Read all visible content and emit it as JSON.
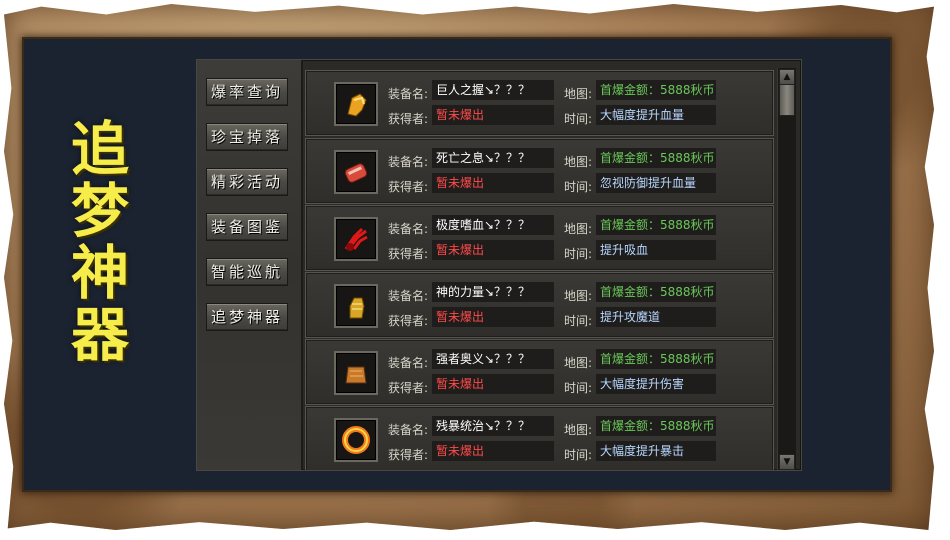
{
  "title": "追梦神器",
  "menu": [
    {
      "label": "爆率查询"
    },
    {
      "label": "珍宝掉落"
    },
    {
      "label": "精彩活动"
    },
    {
      "label": "装备图鉴"
    },
    {
      "label": "智能巡航"
    },
    {
      "label": "追梦神器"
    }
  ],
  "labels": {
    "equip": "装备名:",
    "obtainer": "获得者:",
    "map": "地图:",
    "time": "时间:"
  },
  "items": [
    {
      "icon": "gauntlet-gold-icon",
      "name": "巨人之握↘？？？",
      "obtainer": "暂未爆出",
      "map": "首爆金额：5888秋币",
      "time": "大幅度提升血量"
    },
    {
      "icon": "red-bracer-icon",
      "name": "死亡之息↘？？？",
      "obtainer": "暂未爆出",
      "map": "首爆金额：5888秋币",
      "time": "忽视防御提升血量"
    },
    {
      "icon": "blood-claw-icon",
      "name": "极度嗜血↘？？？",
      "obtainer": "暂未爆出",
      "map": "首爆金额：5888秋币",
      "time": "提升吸血"
    },
    {
      "icon": "golden-fist-icon",
      "name": "神的力量↘？？？",
      "obtainer": "暂未爆出",
      "map": "首爆金额：5888秋币",
      "time": "提升攻魔道"
    },
    {
      "icon": "bronze-bell-icon",
      "name": "强者奥义↘？？？",
      "obtainer": "暂未爆出",
      "map": "首爆金额：5888秋币",
      "time": "大幅度提升伤害"
    },
    {
      "icon": "fire-ring-icon",
      "name": "残暴统治↘？？？",
      "obtainer": "暂未爆出",
      "map": "首爆金额：5888秋币",
      "time": "大幅度提升暴击"
    }
  ],
  "colors": {
    "title": "#f6ec4a",
    "obtainer": "#ff4a4a",
    "map": "#6ac85a",
    "time": "#b8d7ff"
  }
}
